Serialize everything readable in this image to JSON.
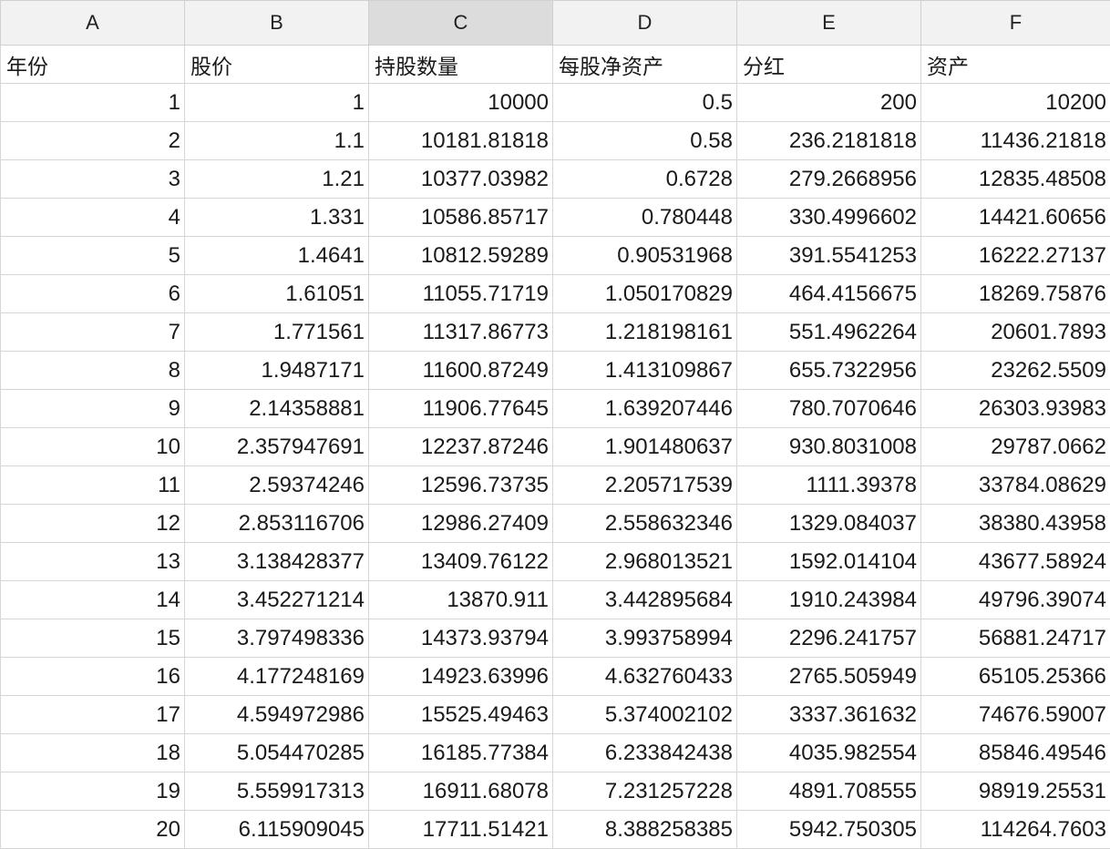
{
  "columns": [
    "A",
    "B",
    "C",
    "D",
    "E",
    "F"
  ],
  "selected_column": "C",
  "header_row": [
    "年份",
    "股价",
    "持股数量",
    "每股净资产",
    "分红",
    "资产"
  ],
  "rows": [
    [
      "1",
      "1",
      "10000",
      "0.5",
      "200",
      "10200"
    ],
    [
      "2",
      "1.1",
      "10181.81818",
      "0.58",
      "236.2181818",
      "11436.21818"
    ],
    [
      "3",
      "1.21",
      "10377.03982",
      "0.6728",
      "279.2668956",
      "12835.48508"
    ],
    [
      "4",
      "1.331",
      "10586.85717",
      "0.780448",
      "330.4996602",
      "14421.60656"
    ],
    [
      "5",
      "1.4641",
      "10812.59289",
      "0.90531968",
      "391.5541253",
      "16222.27137"
    ],
    [
      "6",
      "1.61051",
      "11055.71719",
      "1.050170829",
      "464.4156675",
      "18269.75876"
    ],
    [
      "7",
      "1.771561",
      "11317.86773",
      "1.218198161",
      "551.4962264",
      "20601.7893"
    ],
    [
      "8",
      "1.9487171",
      "11600.87249",
      "1.413109867",
      "655.7322956",
      "23262.5509"
    ],
    [
      "9",
      "2.14358881",
      "11906.77645",
      "1.639207446",
      "780.7070646",
      "26303.93983"
    ],
    [
      "10",
      "2.357947691",
      "12237.87246",
      "1.901480637",
      "930.8031008",
      "29787.0662"
    ],
    [
      "11",
      "2.59374246",
      "12596.73735",
      "2.205717539",
      "1111.39378",
      "33784.08629"
    ],
    [
      "12",
      "2.853116706",
      "12986.27409",
      "2.558632346",
      "1329.084037",
      "38380.43958"
    ],
    [
      "13",
      "3.138428377",
      "13409.76122",
      "2.968013521",
      "1592.014104",
      "43677.58924"
    ],
    [
      "14",
      "3.452271214",
      "13870.911",
      "3.442895684",
      "1910.243984",
      "49796.39074"
    ],
    [
      "15",
      "3.797498336",
      "14373.93794",
      "3.993758994",
      "2296.241757",
      "56881.24717"
    ],
    [
      "16",
      "4.177248169",
      "14923.63996",
      "4.632760433",
      "2765.505949",
      "65105.25366"
    ],
    [
      "17",
      "4.594972986",
      "15525.49463",
      "5.374002102",
      "3337.361632",
      "74676.59007"
    ],
    [
      "18",
      "5.054470285",
      "16185.77384",
      "6.233842438",
      "4035.982554",
      "85846.49546"
    ],
    [
      "19",
      "5.559917313",
      "16911.68078",
      "7.231257228",
      "4891.708555",
      "98919.25531"
    ],
    [
      "20",
      "6.115909045",
      "17711.51421",
      "8.388258385",
      "5942.750305",
      "114264.7603"
    ]
  ]
}
